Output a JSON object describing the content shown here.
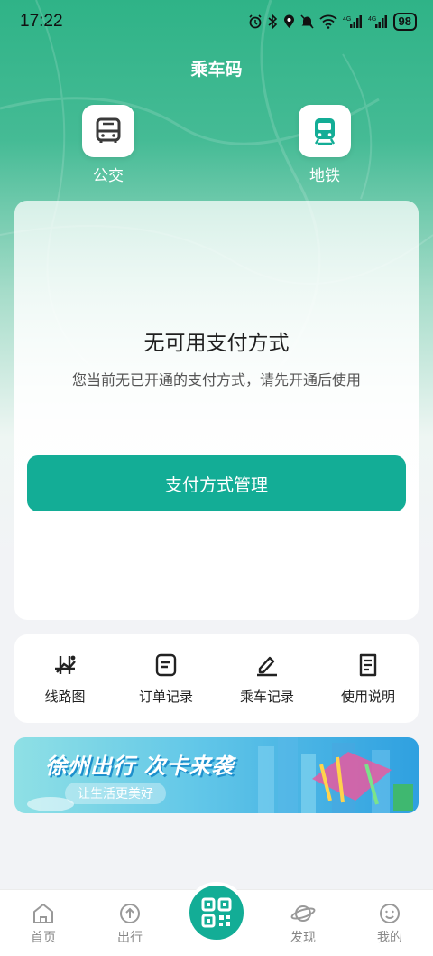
{
  "status_bar": {
    "time": "17:22",
    "battery": "98",
    "icons": [
      "alarm-icon",
      "bluetooth-icon",
      "location-icon",
      "mute-icon",
      "wifi-icon",
      "signal-4g-icon",
      "signal-4g-icon"
    ]
  },
  "header": {
    "title": "乘车码"
  },
  "modes": [
    {
      "label": "公交",
      "icon": "bus-icon"
    },
    {
      "label": "地铁",
      "icon": "metro-icon"
    }
  ],
  "payment": {
    "empty_title": "无可用支付方式",
    "empty_desc": "您当前无已开通的支付方式，请先开通后使用",
    "manage_button": "支付方式管理"
  },
  "shortcuts": [
    {
      "label": "线路图",
      "icon": "route-map-icon"
    },
    {
      "label": "订单记录",
      "icon": "order-record-icon"
    },
    {
      "label": "乘车记录",
      "icon": "ride-record-icon"
    },
    {
      "label": "使用说明",
      "icon": "instructions-icon"
    }
  ],
  "banner": {
    "title": "徐州出行 次卡来袭",
    "subtitle": "让生活更美好"
  },
  "bottom_nav": [
    {
      "label": "首页",
      "icon": "home-icon"
    },
    {
      "label": "出行",
      "icon": "travel-icon"
    },
    {
      "label": "发现",
      "icon": "discover-icon"
    },
    {
      "label": "我的",
      "icon": "profile-icon"
    }
  ],
  "colors": {
    "primary": "#13ad96",
    "header_green": "#2fb387",
    "nav_inactive": "#888888"
  }
}
